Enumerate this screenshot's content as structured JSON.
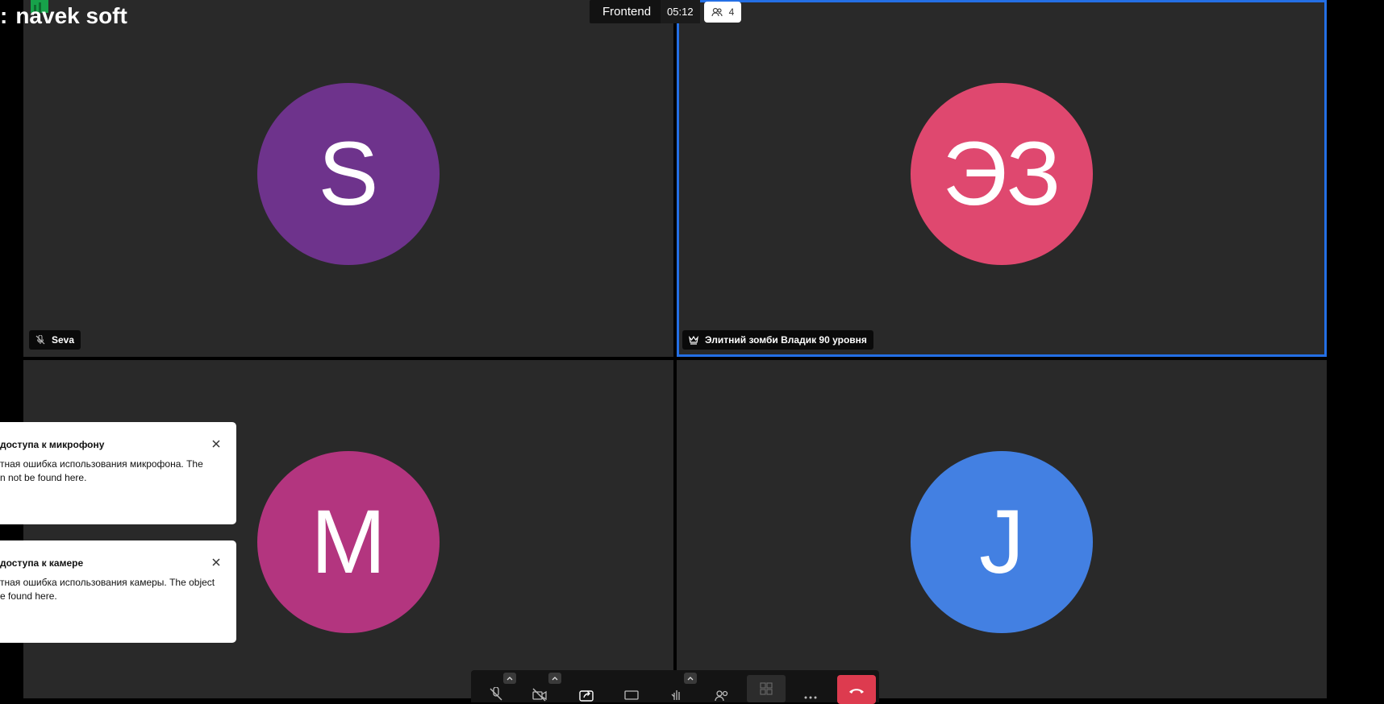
{
  "brand": {
    "logo_text": "navek soft"
  },
  "header": {
    "subject": "Frontend",
    "timer": "05:12",
    "participant_count": "4"
  },
  "participants": [
    {
      "initials": "S",
      "name": "Seva",
      "color": "#6e338c",
      "muted": true
    },
    {
      "initials": "ЭЗ",
      "name": "Элитний зомби Владик 90 уровня",
      "color": "#df486f",
      "moderator": true,
      "dominant": true
    },
    {
      "initials": "M",
      "name": "",
      "color": "#b3357f"
    },
    {
      "initials": "J",
      "name": "",
      "color": "#4380e2"
    }
  ],
  "notifications": [
    {
      "title": "доступа к микрофону",
      "line1": "тная ошибка использования микрофона. The",
      "line2": "n not be found here."
    },
    {
      "title": "доступа к камере",
      "line1": "тная ошибка использования камеры. The object",
      "line2": "e found here."
    }
  ],
  "toolbar": {
    "buttons": [
      "microphone-muted-icon",
      "camera-off-icon",
      "share-screen-icon",
      "chat-icon",
      "raise-hand-icon",
      "participants-icon",
      "tile-view-icon",
      "more-icon",
      "hangup-icon"
    ]
  },
  "colors": {
    "accent": "#246fe5",
    "hangup": "#dd3b4f",
    "tile_bg": "#292929"
  }
}
